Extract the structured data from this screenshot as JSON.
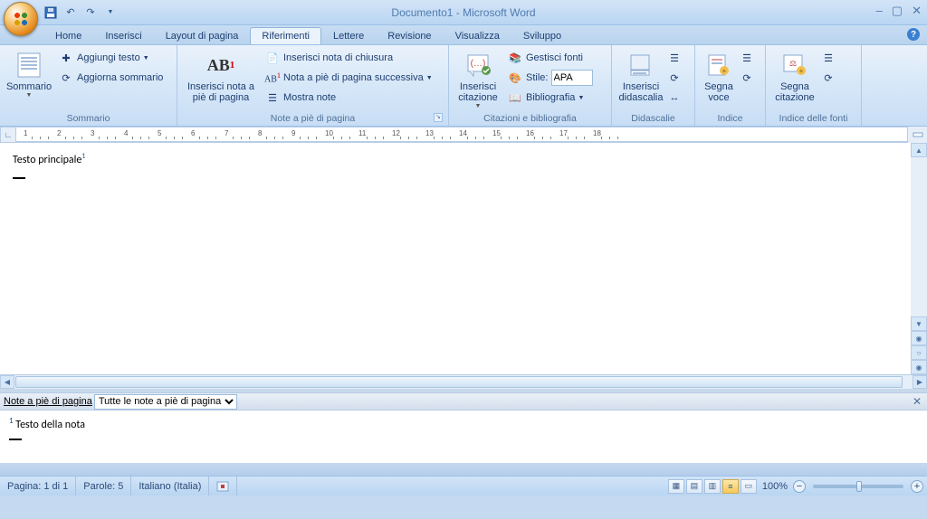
{
  "title": "Documento1 - Microsoft Word",
  "tabs": [
    "Home",
    "Inserisci",
    "Layout di pagina",
    "Riferimenti",
    "Lettere",
    "Revisione",
    "Visualizza",
    "Sviluppo"
  ],
  "active_tab": 3,
  "ribbon": {
    "sommario": {
      "big": "Sommario",
      "add": "Aggiungi testo",
      "upd": "Aggiorna sommario",
      "label": "Sommario"
    },
    "note": {
      "big": "Inserisci nota a piè di pagina",
      "ab": "AB",
      "end": "Inserisci nota di chiusura",
      "next": "Nota a piè di pagina successiva",
      "show": "Mostra note",
      "label": "Note a piè di pagina"
    },
    "cit": {
      "big": "Inserisci citazione",
      "man": "Gestisci fonti",
      "style": "Stile:",
      "style_val": "APA",
      "bib": "Bibliografia",
      "label": "Citazioni e bibliografia"
    },
    "did": {
      "big": "Inserisci didascalia",
      "label": "Didascalie"
    },
    "idx": {
      "big": "Segna voce",
      "label": "Indice"
    },
    "fnt": {
      "big": "Segna citazione",
      "label": "Indice delle fonti"
    }
  },
  "ruler_numbers": [
    1,
    2,
    3,
    4,
    5,
    6,
    7,
    8,
    9,
    10,
    11,
    12,
    13,
    14,
    15,
    16,
    17,
    18
  ],
  "doc_text": "Testo principale",
  "doc_ref": "1",
  "footnote": {
    "label": "Note a piè di pagina",
    "dd": "Tutte le note a piè di pagina",
    "ref": "1",
    "text": "Testo della nota"
  },
  "status": {
    "page": "Pagina: 1 di 1",
    "words": "Parole: 5",
    "lang": "Italiano (Italia)",
    "zoom": "100%"
  }
}
